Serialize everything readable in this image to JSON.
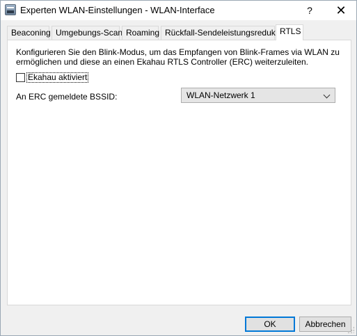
{
  "window": {
    "title": "Experten WLAN-Einstellungen - WLAN-Interface",
    "help_glyph": "?",
    "close_glyph": "✕",
    "app_icon": "dialog-app-icon"
  },
  "tabs": [
    {
      "label": "Beaconing",
      "active": false
    },
    {
      "label": "Umgebungs-Scan",
      "active": false
    },
    {
      "label": "Roaming",
      "active": false
    },
    {
      "label": "Rückfall-Sendeleistungsreduktion",
      "active": false
    },
    {
      "label": "RTLS",
      "active": true
    }
  ],
  "rtls": {
    "intro": "Konfigurieren Sie den Blink-Modus, um das Empfangen von Blink-Frames via WLAN zu ermöglichen und diese an einen Ekahau RTLS Controller (ERC) weiterzuleiten.",
    "ekahau_checkbox": {
      "label": "Ekahau aktiviert",
      "checked": false
    },
    "bssid_label": "An ERC gemeldete BSSID:",
    "bssid_select_value": "WLAN-Netzwerk 1"
  },
  "buttons": {
    "ok": "OK",
    "cancel": "Abbrechen"
  },
  "colors": {
    "accent": "#0078d7",
    "dialog_background": "#f0f0f0",
    "panel_background": "#ffffff"
  }
}
